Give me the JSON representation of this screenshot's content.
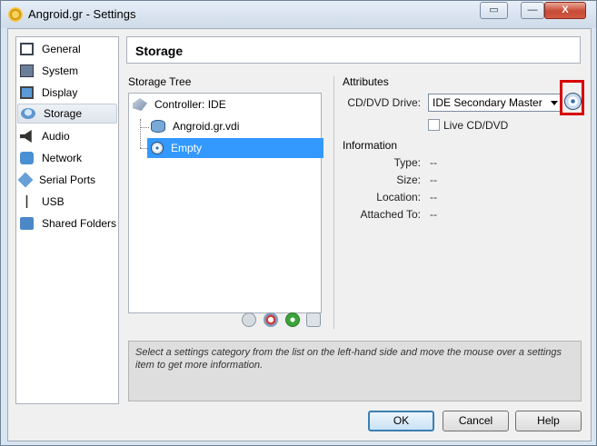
{
  "window": {
    "title": "Angroid.gr - Settings",
    "help_glyph": "▭",
    "minimize_glyph": "—",
    "close_glyph": "X"
  },
  "sidebar": {
    "items": [
      {
        "label": "General",
        "icon": "general-icon"
      },
      {
        "label": "System",
        "icon": "system-icon"
      },
      {
        "label": "Display",
        "icon": "display-icon"
      },
      {
        "label": "Storage",
        "icon": "storage-icon",
        "selected": true
      },
      {
        "label": "Audio",
        "icon": "audio-icon"
      },
      {
        "label": "Network",
        "icon": "network-icon"
      },
      {
        "label": "Serial Ports",
        "icon": "serial-ports-icon"
      },
      {
        "label": "USB",
        "icon": "usb-icon"
      },
      {
        "label": "Shared Folders",
        "icon": "shared-folders-icon"
      }
    ]
  },
  "page": {
    "title": "Storage"
  },
  "storage_tree": {
    "label": "Storage Tree",
    "controller": "Controller: IDE",
    "disk": "Angroid.gr.vdi",
    "cd": "Empty"
  },
  "attributes": {
    "label": "Attributes",
    "drive_label": "CD/DVD Drive:",
    "drive_value": "IDE Secondary Master",
    "live_cd_label": "Live CD/DVD",
    "live_cd_checked": false
  },
  "information": {
    "label": "Information",
    "rows": [
      {
        "label": "Type:",
        "value": "--"
      },
      {
        "label": "Size:",
        "value": "--"
      },
      {
        "label": "Location:",
        "value": "--"
      },
      {
        "label": "Attached To:",
        "value": "--"
      }
    ]
  },
  "description": "Select a settings category from the list on the left-hand side and move the mouse over a settings item to get more information.",
  "buttons": {
    "ok": "OK",
    "cancel": "Cancel",
    "help": "Help"
  },
  "colors": {
    "selection": "#3399ff",
    "highlight": "#d70000"
  }
}
